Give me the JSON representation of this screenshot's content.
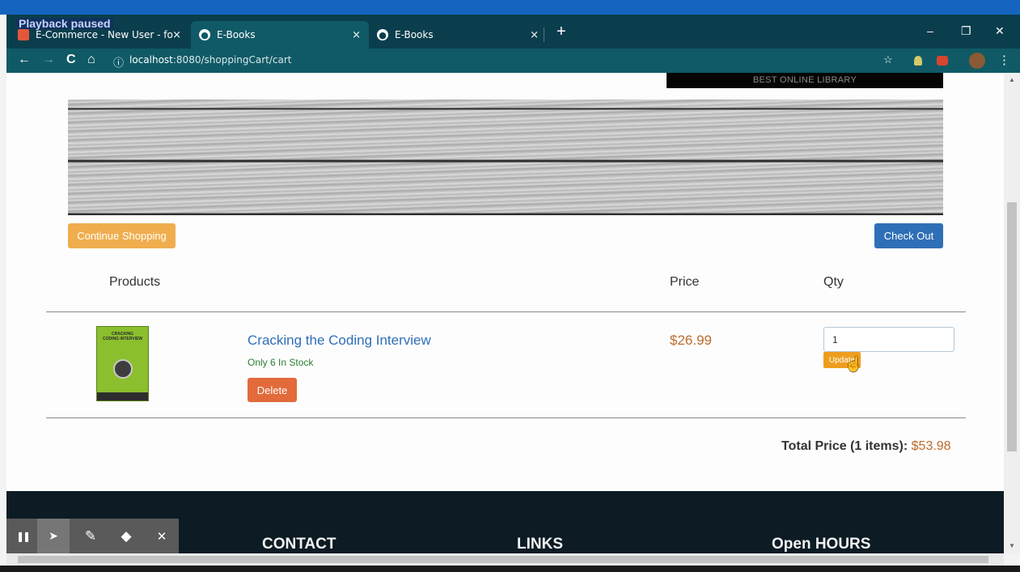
{
  "browser": {
    "overlay": "Playback paused",
    "tabs": [
      {
        "title": "E-Commerce - New User - foysal",
        "close": "×"
      },
      {
        "title": "E-Books",
        "close": "×"
      },
      {
        "title": "E-Books",
        "close": "×"
      }
    ],
    "new_tab": "+",
    "window": {
      "minimize": "–",
      "maximize": "❐",
      "close": "✕"
    },
    "nav": {
      "back": "←",
      "forward": "→",
      "reload": "C",
      "home": "⌂",
      "info": "ⓘ"
    },
    "url_host": "localhost",
    "url_path": ":8080/shoppingCart/cart",
    "star": "☆",
    "menu": "⋮"
  },
  "page": {
    "banner_text": "BEST ONLINE LIBRARY",
    "continue_label": "Continue Shopping",
    "checkout_label": "Check Out",
    "headers": {
      "products": "Products",
      "price": "Price",
      "qty": "Qty"
    },
    "item": {
      "cover_title": "CRACKING",
      "cover_sub": "CODING INTERVIEW",
      "title": "Cracking the Coding Interview",
      "stock": "Only 6 In Stock",
      "delete_label": "Delete",
      "price": "$26.99",
      "qty_value": "1",
      "update_label": "Update"
    },
    "total_label": "Total Price (1 items):",
    "total_amount": "$53.98"
  },
  "footer": {
    "contact": "CONTACT",
    "links": "LINKS",
    "hours": "Open HOURS"
  },
  "recorder": {
    "pause": "❚❚",
    "pointer": "➤",
    "pen": "✎",
    "eraser": "◆",
    "close": "✕"
  }
}
